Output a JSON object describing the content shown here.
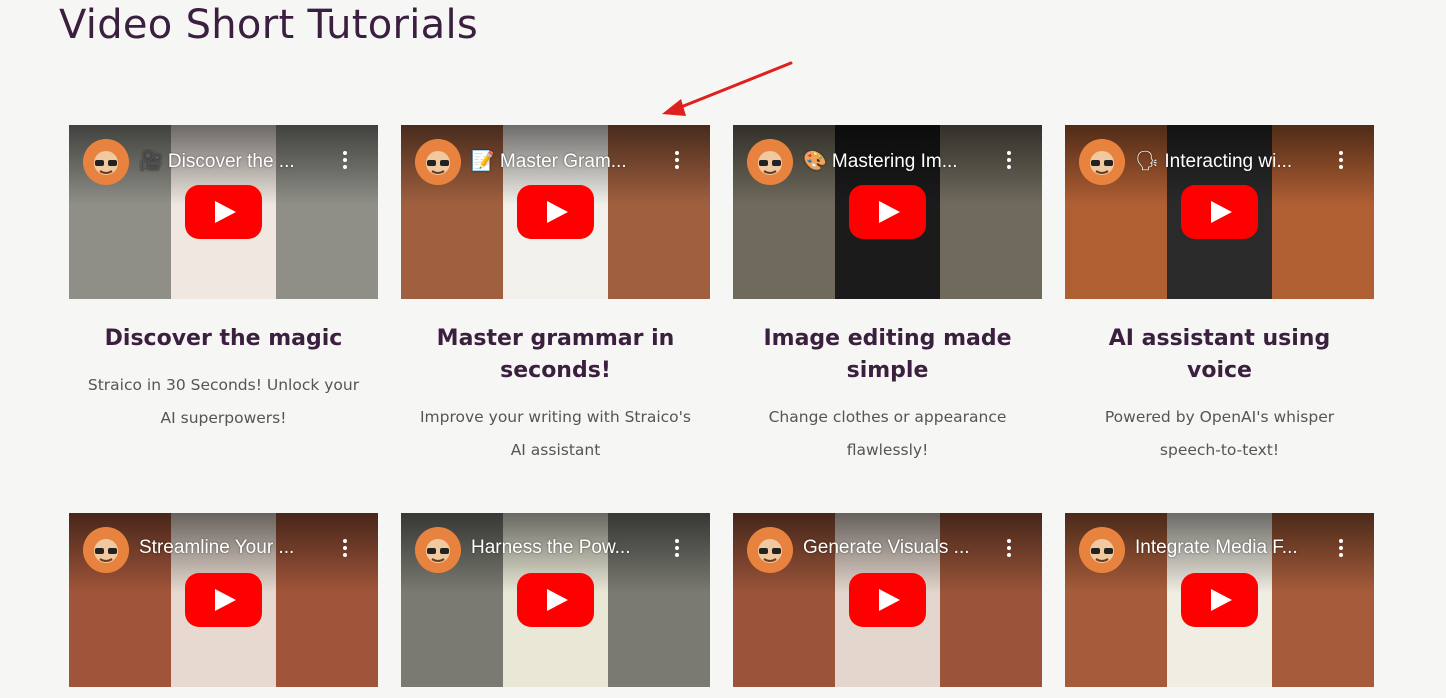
{
  "page": {
    "title": "Video Short Tutorials"
  },
  "colors": {
    "title": "#3a1f3f",
    "youtube_red": "#ff0000",
    "arrow": "#e0201c"
  },
  "cards": [
    {
      "video_title": "🎥 Discover the ...",
      "title": "Discover the magic",
      "description": "Straico in 30 Seconds! Unlock your AI superpowers!"
    },
    {
      "video_title": "📝 Master Gram...",
      "title": "Master grammar in seconds!",
      "description": "Improve your writing with Straico's AI assistant"
    },
    {
      "video_title": "🎨 Mastering Im...",
      "title": "Image editing made simple",
      "description": "Change clothes or appearance flawlessly!"
    },
    {
      "video_title": "🗣 Interacting wi...",
      "title": "AI assistant using voice",
      "description": "Powered by OpenAI's whisper speech-to-text!"
    },
    {
      "video_title": "Streamline Your ...",
      "title": "",
      "description": ""
    },
    {
      "video_title": "Harness the Pow...",
      "title": "",
      "description": ""
    },
    {
      "video_title": "Generate Visuals ...",
      "title": "",
      "description": ""
    },
    {
      "video_title": "Integrate Media F...",
      "title": "",
      "description": ""
    }
  ],
  "icons": {
    "channel": "avatar-icon",
    "play": "youtube-play-icon",
    "menu": "more-vert-icon",
    "annotation": "red-arrow"
  }
}
